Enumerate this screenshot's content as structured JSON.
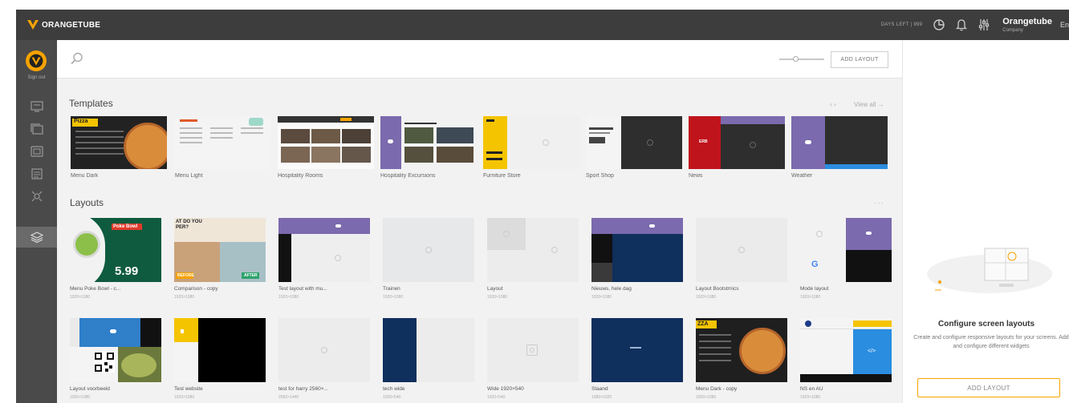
{
  "brand": {
    "name": "ORANGETUBE",
    "accent": "#f5a300"
  },
  "topbar": {
    "days_left": "DAYS LEFT | 999",
    "user_name": "Orangetube",
    "user_role": "Company",
    "language": "En"
  },
  "sidebar": {
    "sign_out": "Sign out",
    "items": [
      {
        "icon": "screens-icon"
      },
      {
        "icon": "playlists-icon"
      },
      {
        "icon": "media-icon"
      },
      {
        "icon": "schedule-icon"
      },
      {
        "icon": "widgets-icon"
      },
      {
        "icon": "layouts-icon",
        "active": true
      }
    ]
  },
  "toolbar": {
    "add_layout": "ADD LAYOUT"
  },
  "templates": {
    "title": "Templates",
    "view_all": "View all →",
    "items": [
      {
        "label": "Menu Dark"
      },
      {
        "label": "Menu Light"
      },
      {
        "label": "Hospitality Rooms"
      },
      {
        "label": "Hospitality Excursions"
      },
      {
        "label": "Furniture Store"
      },
      {
        "label": "Sport Shop"
      },
      {
        "label": "News"
      },
      {
        "label": "Weather"
      }
    ]
  },
  "layouts": {
    "title": "Layouts",
    "more": "···",
    "row1": [
      {
        "label": "Menu Poke Bowl - c...",
        "sub": "1920×1080"
      },
      {
        "label": "Comparison - copy",
        "sub": "1920×1080"
      },
      {
        "label": "Test layout with mu...",
        "sub": "1920×1080"
      },
      {
        "label": "Trainen",
        "sub": "1920×1080"
      },
      {
        "label": "Layout",
        "sub": "1920×1080"
      },
      {
        "label": "Nieuws, hele dag",
        "sub": "1920×1080"
      },
      {
        "label": "Layout Bootstrnics",
        "sub": "1920×1080"
      },
      {
        "label": "Mode layout",
        "sub": "1920×1080"
      }
    ],
    "row2": [
      {
        "label": "Layout voorbeeld",
        "sub": "1920×1080"
      },
      {
        "label": "Test website",
        "sub": "1920×1080"
      },
      {
        "label": "test for harry 2560×...",
        "sub": "2560×1440"
      },
      {
        "label": "tech wide",
        "sub": "1920×540"
      },
      {
        "label": "Wide 1920×540",
        "sub": "1920×540"
      },
      {
        "label": "Staand",
        "sub": "1080×1920"
      },
      {
        "label": "Menu Dark - copy",
        "sub": "1920×1080"
      },
      {
        "label": "NS en AU",
        "sub": "1920×1080"
      }
    ],
    "poke_title": "Poke Bowl",
    "poke_price": "5.99",
    "comparison_head": "AT DO YOU\nPER?",
    "before": "BEFORE",
    "after": "AFTER",
    "pizza_word": "ZZA"
  },
  "template_texts": {
    "pizza": "Pizza",
    "news": "ERB"
  },
  "right_panel": {
    "title": "Configure screen layouts",
    "description": "Create and configure responsive layouts for your screens. Add and configure different widgets",
    "button": "ADD LAYOUT"
  }
}
